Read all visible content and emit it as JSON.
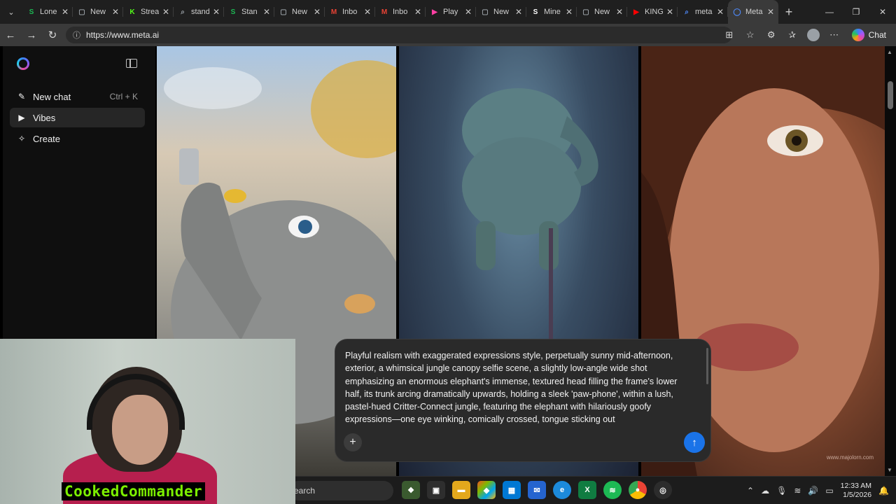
{
  "browser": {
    "tabs": [
      {
        "title": "Lone",
        "icon": "s-icon",
        "glyph": "S",
        "color": "#1db954",
        "active": false
      },
      {
        "title": "New",
        "icon": "new-tab-icon",
        "glyph": "▢",
        "color": "#9aa0a6",
        "active": false
      },
      {
        "title": "Strea",
        "icon": "kick-icon",
        "glyph": "K",
        "color": "#53fc18",
        "active": false
      },
      {
        "title": "stand",
        "icon": "search-icon",
        "glyph": "⌕",
        "color": "#9aa0a6",
        "active": false
      },
      {
        "title": "Stan",
        "icon": "s-icon",
        "glyph": "S",
        "color": "#1db954",
        "active": false
      },
      {
        "title": "New",
        "icon": "new-tab-icon",
        "glyph": "▢",
        "color": "#9aa0a6",
        "active": false
      },
      {
        "title": "Inbo",
        "icon": "gmail-icon",
        "glyph": "M",
        "color": "#ea4335",
        "active": false
      },
      {
        "title": "Inbo",
        "icon": "gmail-icon",
        "glyph": "M",
        "color": "#ea4335",
        "active": false
      },
      {
        "title": "Play",
        "icon": "play-icon",
        "glyph": "▶",
        "color": "#ff3fa4",
        "active": false
      },
      {
        "title": "New",
        "icon": "new-tab-icon",
        "glyph": "▢",
        "color": "#9aa0a6",
        "active": false
      },
      {
        "title": "Mine",
        "icon": "s-icon",
        "glyph": "S",
        "color": "#ffffff",
        "active": false
      },
      {
        "title": "New",
        "icon": "new-tab-icon",
        "glyph": "▢",
        "color": "#9aa0a6",
        "active": false
      },
      {
        "title": "KING",
        "icon": "youtube-icon",
        "glyph": "▶",
        "color": "#ff0000",
        "active": false
      },
      {
        "title": "meta",
        "icon": "search-icon",
        "glyph": "⌕",
        "color": "#4f8cff",
        "active": false
      },
      {
        "title": "Meta",
        "icon": "meta-icon",
        "glyph": "◯",
        "color": "#4f8cff",
        "active": true
      }
    ],
    "url": "https://www.meta.ai",
    "chat_label": "Chat"
  },
  "sidebar": {
    "items": [
      {
        "label": "New chat",
        "shortcut": "Ctrl + K",
        "icon": "edit-icon"
      },
      {
        "label": "Vibes",
        "shortcut": "",
        "icon": "vibes-icon"
      },
      {
        "label": "Create",
        "shortcut": "",
        "icon": "sparkle-icon"
      }
    ]
  },
  "gallery": {
    "tiles": [
      {
        "name": "elephant-selfie"
      },
      {
        "name": "jumping-elephant"
      },
      {
        "name": "freckled-portrait",
        "caption": "www.majolorn.com"
      }
    ]
  },
  "composer": {
    "prompt": "Playful realism with exaggerated expressions style, perpetually sunny mid-afternoon, exterior, a whimsical jungle canopy selfie scene, a slightly low-angle wide shot emphasizing an enormous elephant's immense, textured head filling the frame's lower half, its trunk arcing dramatically upwards, holding a sleek 'paw-phone', within a lush, pastel-hued Critter-Connect jungle, featuring the elephant with hilariously goofy expressions—one eye winking, comically crossed, tongue sticking out"
  },
  "taskbar": {
    "search_placeholder": "earch",
    "time": "12:33 AM",
    "date": "1/5/2026"
  },
  "webcam": {
    "label": "CookedCommander"
  }
}
